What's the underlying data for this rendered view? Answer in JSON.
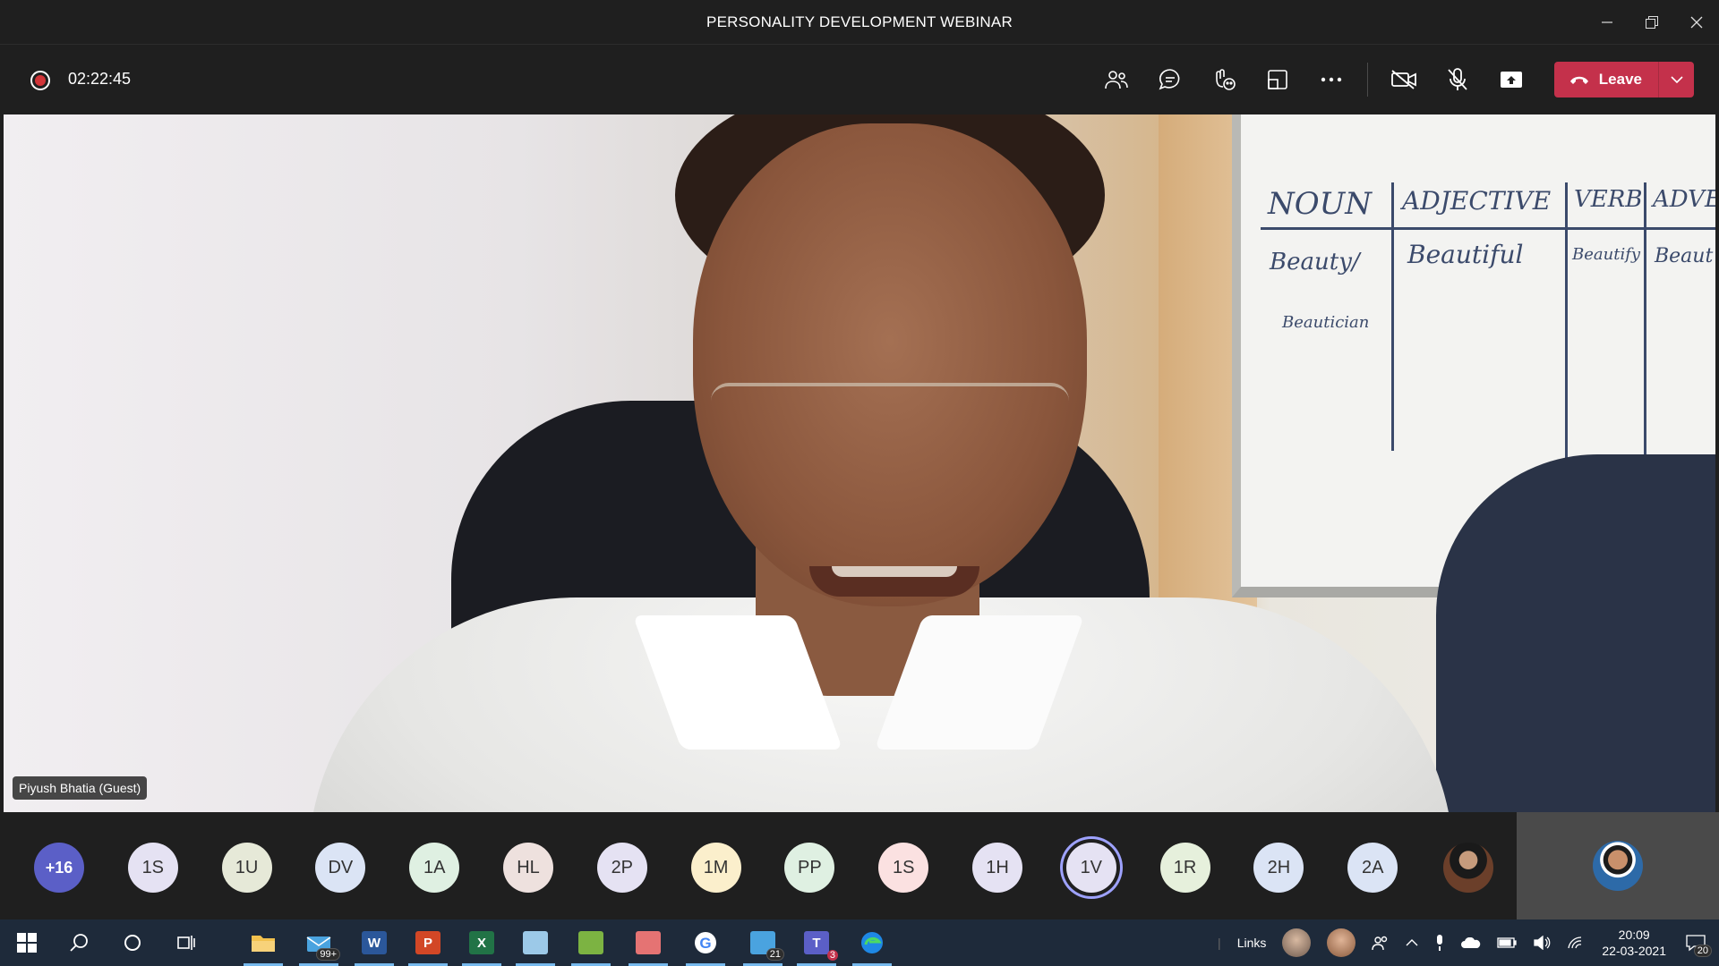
{
  "window": {
    "title": "PERSONALITY DEVELOPMENT WEBINAR"
  },
  "toolbar": {
    "timer": "02:22:45",
    "leave_label": "Leave",
    "icons": [
      "people-icon",
      "chat-icon",
      "reactions-icon",
      "room-icon",
      "more-icon",
      "camera-off-icon",
      "mic-off-icon",
      "share-icon"
    ]
  },
  "video": {
    "participant_name": "Piyush Bhatia (Guest)",
    "whiteboard": {
      "headers": [
        "NOUN",
        "ADJECTIVE",
        "VERB",
        "ADVER"
      ],
      "row1": [
        "Beauty/",
        "Beautiful",
        "Beautify",
        "Beaut"
      ],
      "row2": [
        "Beautician"
      ]
    }
  },
  "participants": [
    {
      "initials": "+16",
      "color": "#5b5fc7",
      "more": true
    },
    {
      "initials": "1S",
      "color": "#e5e2f3"
    },
    {
      "initials": "1U",
      "color": "#e6e9d8"
    },
    {
      "initials": "DV",
      "color": "#dbe4f5"
    },
    {
      "initials": "1A",
      "color": "#dff0e2"
    },
    {
      "initials": "HL",
      "color": "#eee1de"
    },
    {
      "initials": "2P",
      "color": "#e5e2f3"
    },
    {
      "initials": "1M",
      "color": "#fbefcc"
    },
    {
      "initials": "PP",
      "color": "#dff0e2"
    },
    {
      "initials": "1S",
      "color": "#fbe1e1"
    },
    {
      "initials": "1H",
      "color": "#e5e2f3"
    },
    {
      "initials": "1V",
      "color": "#e5e2f3",
      "speaking": true
    },
    {
      "initials": "1R",
      "color": "#e6f0dc"
    },
    {
      "initials": "2H",
      "color": "#dbe4f5"
    },
    {
      "initials": "2A",
      "color": "#dbe4f5"
    }
  ],
  "taskbar": {
    "apps": [
      {
        "name": "start-icon"
      },
      {
        "name": "search-icon"
      },
      {
        "name": "cortana-icon"
      },
      {
        "name": "task-view-icon"
      },
      {
        "name": "file-explorer-icon",
        "color": "#f2c14e"
      },
      {
        "name": "mail-icon",
        "badge": "99+"
      },
      {
        "name": "word-icon",
        "letter": "W",
        "color": "#2b579a"
      },
      {
        "name": "powerpoint-icon",
        "letter": "P",
        "color": "#d24726"
      },
      {
        "name": "excel-icon",
        "letter": "X",
        "color": "#217346"
      },
      {
        "name": "notepad-icon",
        "color": "#9cc9e8"
      },
      {
        "name": "paint-icon",
        "color": "#7cb342"
      },
      {
        "name": "snip-icon",
        "color": "#e57373"
      },
      {
        "name": "google-icon",
        "color": "#ffffff"
      },
      {
        "name": "phone-icon",
        "badge": "21",
        "color": "#4aa3df"
      },
      {
        "name": "teams-icon",
        "letter": "T",
        "badge": "3",
        "color": "#5b5fc7"
      },
      {
        "name": "edge-icon",
        "color": "#1e88e5"
      }
    ],
    "links_label": "Links",
    "time": "20:09",
    "date": "22-03-2021",
    "notifications": "20"
  }
}
